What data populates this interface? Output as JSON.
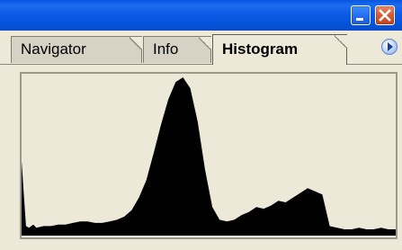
{
  "titlebar": {
    "minimize_icon": "minimize-icon",
    "close_icon": "close-icon"
  },
  "tabs": [
    {
      "label": "Navigator",
      "active": false
    },
    {
      "label": "Info",
      "active": false
    },
    {
      "label": "Histogram",
      "active": true
    }
  ],
  "panel_menu_icon": "triangle-right-icon",
  "colors": {
    "titlebar": "#0A55E0",
    "panel_bg": "#ECE9D8",
    "histogram_fill": "#000000"
  },
  "chart_data": {
    "type": "area",
    "x": [
      0,
      3,
      5,
      8,
      10,
      15,
      20,
      25,
      30,
      35,
      40,
      45,
      50,
      55,
      60,
      65,
      70,
      75,
      80,
      85,
      90,
      95,
      100,
      105,
      110,
      115,
      120,
      125,
      130,
      135,
      140,
      145,
      150,
      155,
      160,
      165,
      170,
      175,
      180,
      185,
      190,
      195,
      200,
      205,
      210,
      215,
      220,
      225,
      230,
      235,
      240,
      245,
      250,
      255
    ],
    "values": [
      0.47,
      0.06,
      0.05,
      0.07,
      0.05,
      0.06,
      0.06,
      0.07,
      0.07,
      0.08,
      0.09,
      0.09,
      0.08,
      0.08,
      0.09,
      0.1,
      0.12,
      0.16,
      0.24,
      0.35,
      0.52,
      0.7,
      0.86,
      0.97,
      1.0,
      0.93,
      0.72,
      0.42,
      0.18,
      0.1,
      0.09,
      0.1,
      0.13,
      0.15,
      0.18,
      0.17,
      0.19,
      0.22,
      0.21,
      0.24,
      0.27,
      0.3,
      0.28,
      0.26,
      0.06,
      0.05,
      0.04,
      0.04,
      0.05,
      0.04,
      0.04,
      0.05,
      0.04,
      0.04
    ],
    "xlim": [
      0,
      255
    ],
    "ylim": [
      0,
      1
    ],
    "grid": false
  }
}
